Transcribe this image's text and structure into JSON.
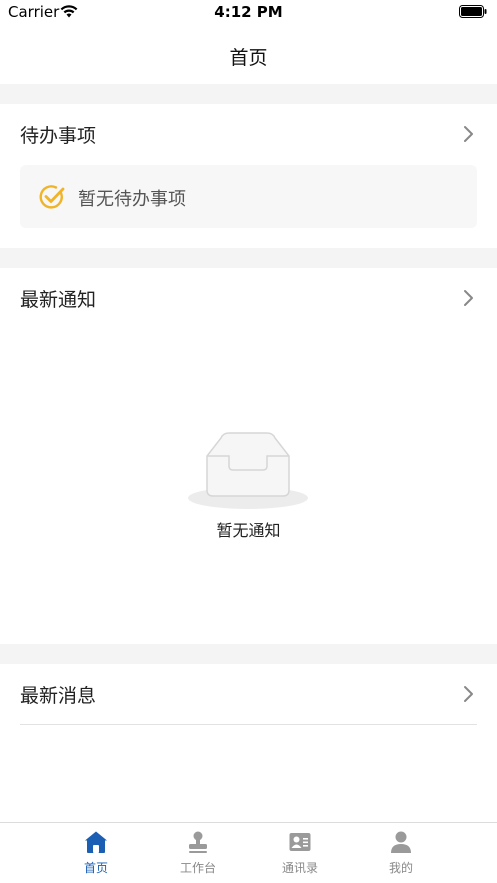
{
  "status_bar": {
    "carrier": "Carrier",
    "time": "4:12 PM"
  },
  "nav": {
    "title": "首页"
  },
  "todo": {
    "title": "待办事项",
    "empty_text": "暂无待办事项"
  },
  "notices": {
    "title": "最新通知",
    "empty_text": "暂无通知"
  },
  "messages": {
    "title": "最新消息"
  },
  "tabs": [
    {
      "label": "首页",
      "icon": "home-icon",
      "active": true
    },
    {
      "label": "工作台",
      "icon": "stamp-icon",
      "active": false
    },
    {
      "label": "通讯录",
      "icon": "contact-card-icon",
      "active": false
    },
    {
      "label": "我的",
      "icon": "person-icon",
      "active": false
    }
  ],
  "colors": {
    "accent": "#1a5fb4",
    "check": "#f0b429",
    "inactive": "#888888",
    "background_gap": "#f4f4f4"
  }
}
